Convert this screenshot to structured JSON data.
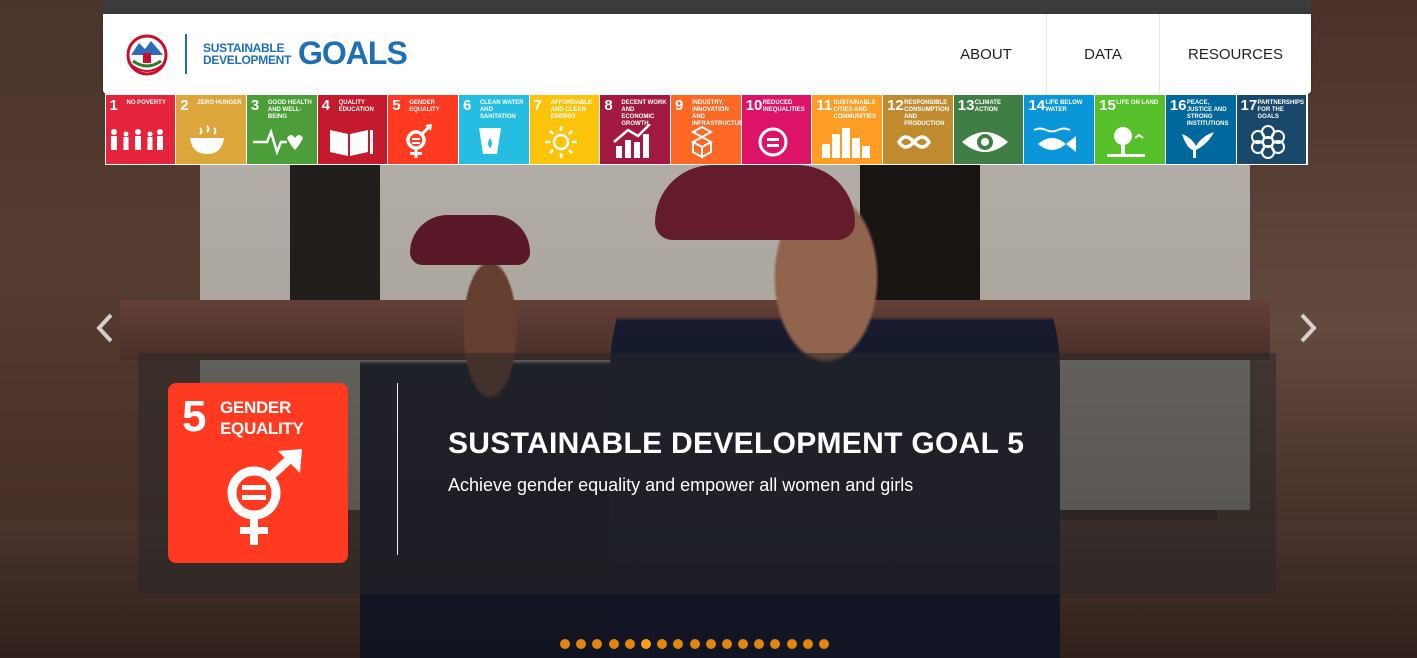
{
  "header": {
    "brand_line1": "SUSTAINABLE",
    "brand_line2": "DEVELOPMENT",
    "brand_goals": "GOALS",
    "nav": [
      {
        "label": "ABOUT"
      },
      {
        "label": "DATA"
      },
      {
        "label": "RESOURCES"
      }
    ]
  },
  "goals": [
    {
      "num": "1",
      "label": "No Poverty",
      "color": "#e5243b",
      "icon": "family-icon"
    },
    {
      "num": "2",
      "label": "Zero Hunger",
      "color": "#dda63a",
      "icon": "bowl-icon"
    },
    {
      "num": "3",
      "label": "Good Health and Well-Being",
      "color": "#4c9f38",
      "icon": "heartbeat-icon"
    },
    {
      "num": "4",
      "label": "Quality Education",
      "color": "#c5192d",
      "icon": "book-icon"
    },
    {
      "num": "5",
      "label": "Gender Equality",
      "color": "#ff3a21",
      "icon": "gender-icon"
    },
    {
      "num": "6",
      "label": "Clean Water and Sanitation",
      "color": "#26bde2",
      "icon": "water-drop-icon"
    },
    {
      "num": "7",
      "label": "Affordable and Clean Energy",
      "color": "#fcc30b",
      "icon": "sun-icon"
    },
    {
      "num": "8",
      "label": "Decent Work and Economic Growth",
      "color": "#a21942",
      "icon": "growth-chart-icon"
    },
    {
      "num": "9",
      "label": "Industry, Innovation and Infrastructure",
      "color": "#fd6925",
      "icon": "cubes-icon"
    },
    {
      "num": "10",
      "label": "Reduced Inequalities",
      "color": "#dd1367",
      "icon": "equal-icon"
    },
    {
      "num": "11",
      "label": "Sustainable Cities and Communities",
      "color": "#fd9d24",
      "icon": "city-icon"
    },
    {
      "num": "12",
      "label": "Responsible Consumption and Production",
      "color": "#bf8b2e",
      "icon": "infinity-icon"
    },
    {
      "num": "13",
      "label": "Climate Action",
      "color": "#3f7e44",
      "icon": "eye-globe-icon"
    },
    {
      "num": "14",
      "label": "Life Below Water",
      "color": "#0a97d9",
      "icon": "fish-icon"
    },
    {
      "num": "15",
      "label": "Life On Land",
      "color": "#56c02b",
      "icon": "tree-icon"
    },
    {
      "num": "16",
      "label": "Peace, Justice and Strong Institutions",
      "color": "#00689d",
      "icon": "dove-icon"
    },
    {
      "num": "17",
      "label": "Partnerships for the Goals",
      "color": "#19486a",
      "icon": "flower-icon"
    }
  ],
  "slide": {
    "goal_number": "5",
    "goal_label": "GENDER\nEQUALITY",
    "goal_color": "#ff3a21",
    "title": "SUSTAINABLE DEVELOPMENT GOAL 5",
    "subtitle": "Achieve gender equality and empower all women and girls"
  },
  "carousel": {
    "dot_count": 17,
    "active_index": 5,
    "dot_color": "#e0860f",
    "active_dot_color": "#f7a21a"
  }
}
